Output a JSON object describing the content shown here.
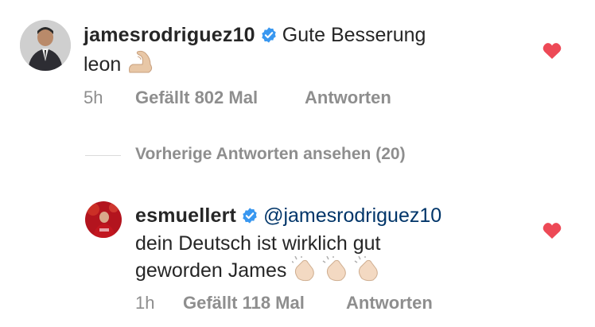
{
  "comments": [
    {
      "username": "jamesrodriguez10",
      "verified": true,
      "text_line1": "Gute Besserung",
      "text_line2": "leon",
      "emoji": "flexed-biceps",
      "time": "5h",
      "likes": "Gefällt 802 Mal",
      "reply": "Antworten",
      "liked": true
    },
    {
      "username": "esmuellert",
      "verified": true,
      "mention": "@jamesrodriguez10",
      "text_line1": "dein Deutsch ist wirklich gut",
      "text_line2": "geworden James",
      "emoji": "clapping-hands",
      "time": "1h",
      "likes": "Gefällt 118 Mal",
      "reply": "Antworten",
      "liked": true
    }
  ],
  "view_previous_replies": "Vorherige Antworten ansehen (20)",
  "colors": {
    "text": "#262626",
    "meta": "#8e8e8e",
    "verified": "#3897f0",
    "heart": "#ed4956",
    "mention": "#003569"
  }
}
